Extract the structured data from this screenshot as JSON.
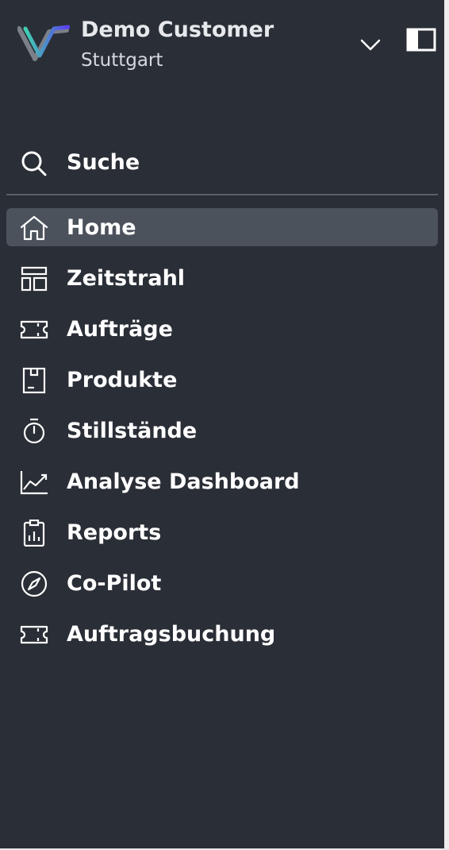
{
  "header": {
    "org_name": "Demo Customer",
    "org_city": "Stuttgart",
    "logo_icon": "brand-v-logo-icon",
    "dropdown_icon": "chevron-down-icon",
    "panel_icon": "sidebar-toggle-icon"
  },
  "search": {
    "label": "Suche",
    "icon": "search-icon"
  },
  "nav": {
    "active_index": 0,
    "items": [
      {
        "label": "Home",
        "icon": "home-icon"
      },
      {
        "label": "Zeitstrahl",
        "icon": "timeline-icon"
      },
      {
        "label": "Aufträge",
        "icon": "ticket-icon"
      },
      {
        "label": "Produkte",
        "icon": "product-box-icon"
      },
      {
        "label": "Stillstände",
        "icon": "stopwatch-icon"
      },
      {
        "label": "Analyse Dashboard",
        "icon": "chart-line-icon"
      },
      {
        "label": "Reports",
        "icon": "clipboard-report-icon"
      },
      {
        "label": "Co-Pilot",
        "icon": "compass-icon"
      },
      {
        "label": "Auftragsbuchung",
        "icon": "ticket-icon"
      }
    ]
  },
  "colors": {
    "sidebar_bg": "#2a2e36",
    "active_bg": "#4c525c",
    "text": "#ffffff",
    "divider": "#5a5f68",
    "logo_gradient_start": "#3fd1b0",
    "logo_gradient_end": "#5b3ff0"
  }
}
